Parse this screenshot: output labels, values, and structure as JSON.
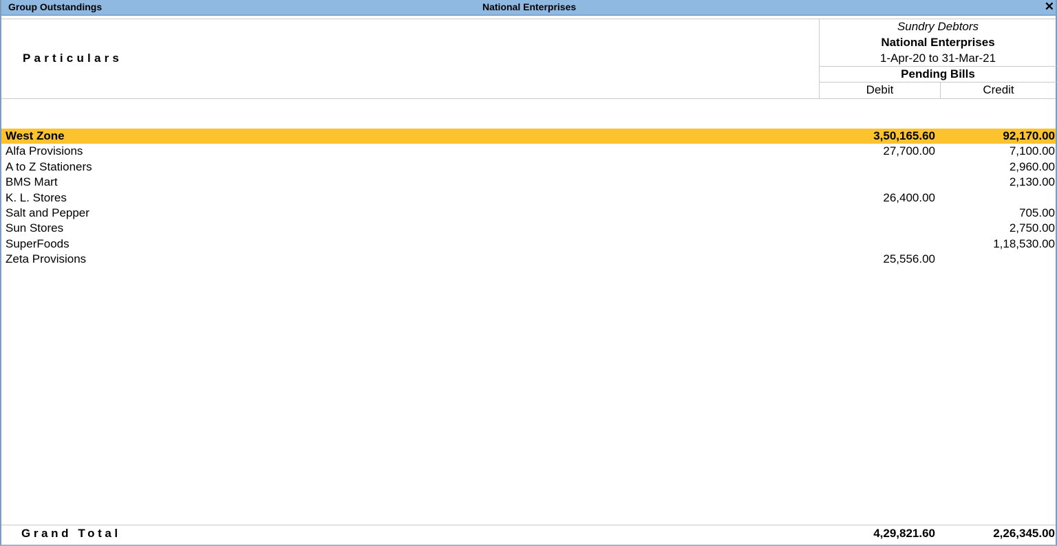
{
  "window": {
    "title": "Group Outstandings",
    "company": "National Enterprises",
    "close_symbol": "✕"
  },
  "header": {
    "particulars_label": "Particulars",
    "group_name": "Sundry Debtors",
    "company_name": "National Enterprises",
    "period": "1-Apr-20 to 31-Mar-21",
    "section_label": "Pending Bills",
    "debit_label": "Debit",
    "credit_label": "Credit"
  },
  "rows": [
    {
      "name": "West Zone",
      "debit": "3,50,165.60",
      "credit": "92,170.00",
      "highlighted": true
    },
    {
      "name": "Alfa Provisions",
      "debit": "27,700.00",
      "credit": "7,100.00"
    },
    {
      "name": "A to Z Stationers",
      "debit": "",
      "credit": "2,960.00"
    },
    {
      "name": "BMS Mart",
      "debit": "",
      "credit": "2,130.00"
    },
    {
      "name": "K. L. Stores",
      "debit": "26,400.00",
      "credit": ""
    },
    {
      "name": "Salt and Pepper",
      "debit": "",
      "credit": "705.00"
    },
    {
      "name": "Sun Stores",
      "debit": "",
      "credit": "2,750.00"
    },
    {
      "name": "SuperFoods",
      "debit": "",
      "credit": "1,18,530.00"
    },
    {
      "name": "Zeta Provisions",
      "debit": "25,556.00",
      "credit": ""
    }
  ],
  "footer": {
    "label": "Grand Total",
    "debit": "4,29,821.60",
    "credit": "2,26,345.00"
  },
  "colors": {
    "titlebar": "#8fb9e0",
    "highlight": "#fdc32e"
  }
}
